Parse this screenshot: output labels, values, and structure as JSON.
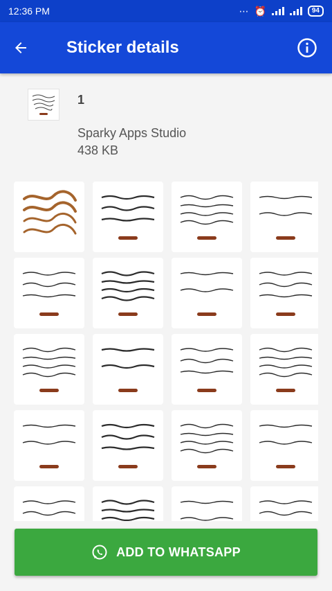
{
  "status": {
    "time": "12:36 PM",
    "battery": "94"
  },
  "toolbar": {
    "title": "Sticker details"
  },
  "pack": {
    "name": "1",
    "publisher": "Sparky Apps Studio",
    "size": "438 KB"
  },
  "stickers": {
    "count": 20,
    "style": "arabic-calligraphy-dua",
    "ink_color": "#2b2b2b",
    "badge_color": "#8a3b1c",
    "logo_color": "#a5642c"
  },
  "footer": {
    "add_label": "ADD TO WHATSAPP"
  },
  "colors": {
    "status_bar": "#0d40c9",
    "app_bar": "#1448d8",
    "button": "#3ba83f"
  }
}
